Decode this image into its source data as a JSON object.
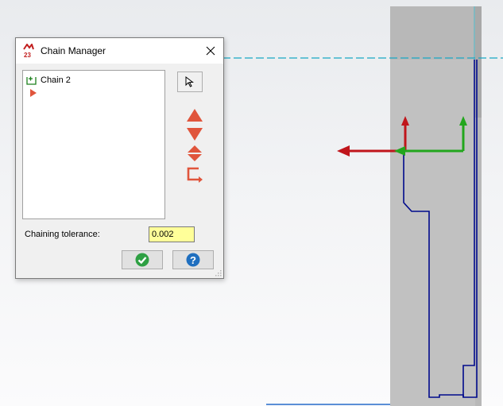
{
  "dialog": {
    "title": "Chain Manager",
    "chains": [
      {
        "label": "Chain 2"
      }
    ],
    "tolerance_label": "Chaining tolerance:",
    "tolerance_value": "0.002",
    "icons": {
      "app": "mastercam-2023-icon",
      "close": "close-icon",
      "select": "cursor-arrow-icon",
      "move_up": "move-up-icon",
      "move_down": "move-down-icon",
      "move_both": "reorder-icon",
      "start_point": "chain-start-icon",
      "ok": "checkmark-icon",
      "help": "help-icon",
      "chain": "chain-add-icon",
      "current": "current-chain-arrow-icon"
    }
  },
  "colors": {
    "ok": "#2ea043",
    "help": "#1f6fbf",
    "arrow_red": "#e0553c",
    "tolerance_bg": "#ffff99",
    "contour": "#000a8c",
    "axis_red": "#c0151b",
    "axis_green": "#22a61d",
    "stock_gray": "#b8b8b8"
  }
}
